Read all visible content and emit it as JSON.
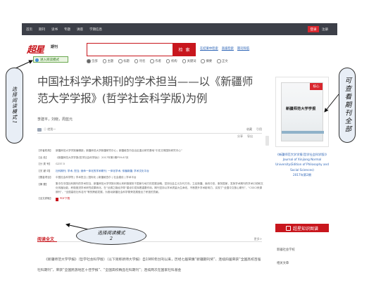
{
  "topbar": {
    "nav": [
      "首页",
      "期刊",
      "读书",
      "专题",
      "讲座",
      "学期信息"
    ],
    "login": "登录",
    "register": "注册"
  },
  "logo": {
    "brand": "超星",
    "sub": "期刊",
    "mode_button": "进入阅读模式"
  },
  "search": {
    "button": "检 索",
    "links": [
      "在结果中检索",
      "高级检索",
      "期刊导航"
    ],
    "scope": [
      "全部",
      "主题",
      "标题",
      "刊名",
      "作者",
      "机构",
      "关键词",
      "摘要",
      "正文"
    ],
    "selected_scope": "全部"
  },
  "article": {
    "title": "中国社科学术期刊的学术担当——以《新疆师范大学学报》(哲学社会科学版)为例",
    "authors": "李建平，刘晓，周蓝元",
    "toolbar_left": "Ⓘ 就我一",
    "toolbar_right": [
      "收藏",
      "引用"
    ],
    "toolbar_right2": [
      "分享",
      "导出"
    ],
    "meta": [
      {
        "k": "【作者机构】",
        "v": "新疆师范大学学报编辑部；新疆师范大学新疆研究中心；新疆维吾尔自治区重点研究基地“中亚文明国际研究中心”"
      },
      {
        "k": "【出 处】",
        "v": "《新疆师范大学学报(哲学社会科学版)》 2017年第2期P59-67页"
      },
      {
        "k": "【分 类 号】",
        "v": "G237.5"
      },
      {
        "k": "【关 键 词】",
        "v": "社科期刊; 学术; 担当; 使命一体化的学术期刊; 一体化学术; 传播新疆; 学术文化平台",
        "link": true
      },
      {
        "k": "【基金项目】",
        "v": "中国社会科学院 | 学术担当 | 国际化 | 新疆维吾尔 | 社会建设 | 学术平台"
      }
    ],
    "abstract_label": "【摘 要】",
    "abstract": "集中在中国社科期刊的学术担当，新疆师范大学学报长期以来积极服务于国家与地方的发展战略，坚持社会主义办刊方向，立足新疆、面向中亚、服务国家，发挥学术期刊的学术引领和文化传播功能，积极推进学术研究成果转化，在“丝绸之路经济带”建设中发挥着重要作用。期刊坚持以学术质量为生命线，不断提升学术影响力，实现了“全国中文核心期刊”、“CSSCI来源期刊”、“全国高校社科名刊”等的跨越发展，为推动新疆社会科学繁荣发展做出了积极的贡献。",
    "pdf_label": "【全文获取】",
    "pdf_link": "PDF下载",
    "read_tab": "阅读全文",
    "read_more": "更多>",
    "fulltext": "《新疆师范大学学报》（哲学社会科学版）（以下简称新师大学报）自1980年创刊以来，历经七届荣膺“新疆期刊奖”、连续四届荣获“全国高校百强社科期刊”，荣获“全国民族地区十佳学报”、“全国高校精品社科期刊”；连续两次在国家社科基金"
  },
  "sidebar": {
    "cover_ribbon": "核心",
    "cover_title": "新疆师范大学学报",
    "cover_text": [
      "《新疆师范大学学报(哲学社会科学版)》",
      "Journal of Xinjiang Normal University(Edition of Philosophy and Social Sciences)",
      "2017年第2期"
    ],
    "kg_title": "超星知识图谱",
    "kg_items": [
      "新疆社会学校",
      "相关文章"
    ]
  },
  "annotations": {
    "left": "选择阅读模式1",
    "right": "可查看期刊全部",
    "middle_line1": "选择阅读模式",
    "middle_line2": "2"
  }
}
